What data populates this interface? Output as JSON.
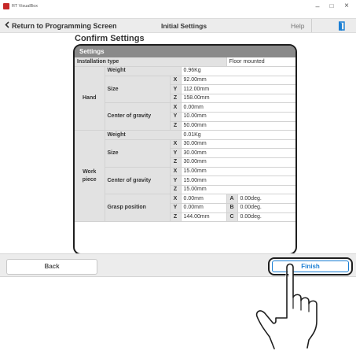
{
  "window": {
    "title": "RT VisualBox",
    "minimize": "–",
    "maximize": "□",
    "close": "×"
  },
  "header": {
    "back_label": "Return to Programming Screen",
    "center_title": "Initial Settings",
    "help_label": "Help",
    "exit_icon": "exit-door-icon"
  },
  "page": {
    "title": "Confirm Settings"
  },
  "settings": {
    "section_title": "Settings",
    "installation": {
      "label": "Installation type",
      "value": "Floor mounted"
    },
    "hand": {
      "label": "Hand",
      "weight_label": "Weight",
      "weight": "0.96Kg",
      "size_label": "Size",
      "size": [
        {
          "axis": "X",
          "value": "92.00mm"
        },
        {
          "axis": "Y",
          "value": "112.00mm"
        },
        {
          "axis": "Z",
          "value": "158.00mm"
        }
      ],
      "cog_label": "Center of gravity",
      "cog": [
        {
          "axis": "X",
          "value": "0.00mm"
        },
        {
          "axis": "Y",
          "value": "10.00mm"
        },
        {
          "axis": "Z",
          "value": "50.00mm"
        }
      ]
    },
    "workpiece": {
      "label": "Work piece",
      "weight_label": "Weight",
      "weight": "0.01Kg",
      "size_label": "Size",
      "size": [
        {
          "axis": "X",
          "value": "30.00mm"
        },
        {
          "axis": "Y",
          "value": "30.00mm"
        },
        {
          "axis": "Z",
          "value": "30.00mm"
        }
      ],
      "cog_label": "Center of gravity",
      "cog": [
        {
          "axis": "X",
          "value": "15.00mm"
        },
        {
          "axis": "Y",
          "value": "15.00mm"
        },
        {
          "axis": "Z",
          "value": "15.00mm"
        }
      ],
      "grasp_label": "Grasp position",
      "grasp": [
        {
          "axis": "X",
          "value": "0.00mm",
          "rot_axis": "A",
          "rot_value": "0.00deg."
        },
        {
          "axis": "Y",
          "value": "0.00mm",
          "rot_axis": "B",
          "rot_value": "0.00deg."
        },
        {
          "axis": "Z",
          "value": "144.00mm",
          "rot_axis": "C",
          "rot_value": "0.00deg."
        }
      ]
    }
  },
  "footer": {
    "back_label": "Back",
    "finish_label": "Finish"
  },
  "colors": {
    "accent": "#1b7fd4",
    "panel_header": "#8a8a8a",
    "label_cell": "#e2e2e2",
    "highlight": "#1e1e1e"
  }
}
